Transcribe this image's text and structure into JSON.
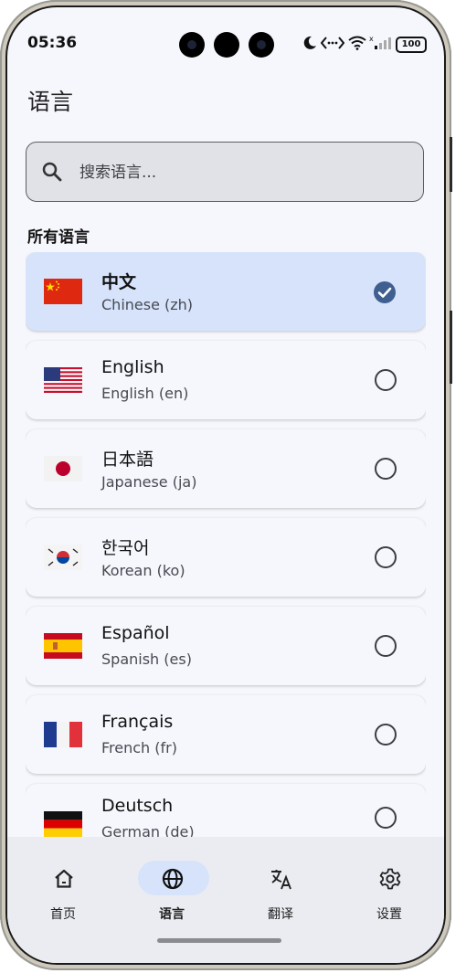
{
  "status_bar": {
    "time": "05:36",
    "battery": "100"
  },
  "header": {
    "title": "语言"
  },
  "search": {
    "placeholder": "搜索语言..."
  },
  "section": {
    "all_languages": "所有语言"
  },
  "languages": [
    {
      "name": "中文",
      "subtitle": "Chinese (zh)",
      "selected": true,
      "flag": "china-flag"
    },
    {
      "name": "English",
      "subtitle": "English (en)",
      "selected": false,
      "flag": "us-flag"
    },
    {
      "name": "日本語",
      "subtitle": "Japanese (ja)",
      "selected": false,
      "flag": "japan-flag"
    },
    {
      "name": "한국어",
      "subtitle": "Korean (ko)",
      "selected": false,
      "flag": "korea-flag"
    },
    {
      "name": "Español",
      "subtitle": "Spanish (es)",
      "selected": false,
      "flag": "spain-flag"
    },
    {
      "name": "Français",
      "subtitle": "French (fr)",
      "selected": false,
      "flag": "france-flag"
    },
    {
      "name": "Deutsch",
      "subtitle": "German (de)",
      "selected": false,
      "flag": "germany-flag"
    }
  ],
  "bottom_nav": {
    "items": [
      {
        "label": "首页",
        "icon": "home-icon",
        "active": false
      },
      {
        "label": "语言",
        "icon": "globe-icon",
        "active": true
      },
      {
        "label": "翻译",
        "icon": "translate-icon",
        "active": false
      },
      {
        "label": "设置",
        "icon": "gear-icon",
        "active": false
      }
    ]
  },
  "colors": {
    "selected_bg": "#d6e3fb",
    "accent": "#3f5f90",
    "background": "#f6f7fc"
  }
}
